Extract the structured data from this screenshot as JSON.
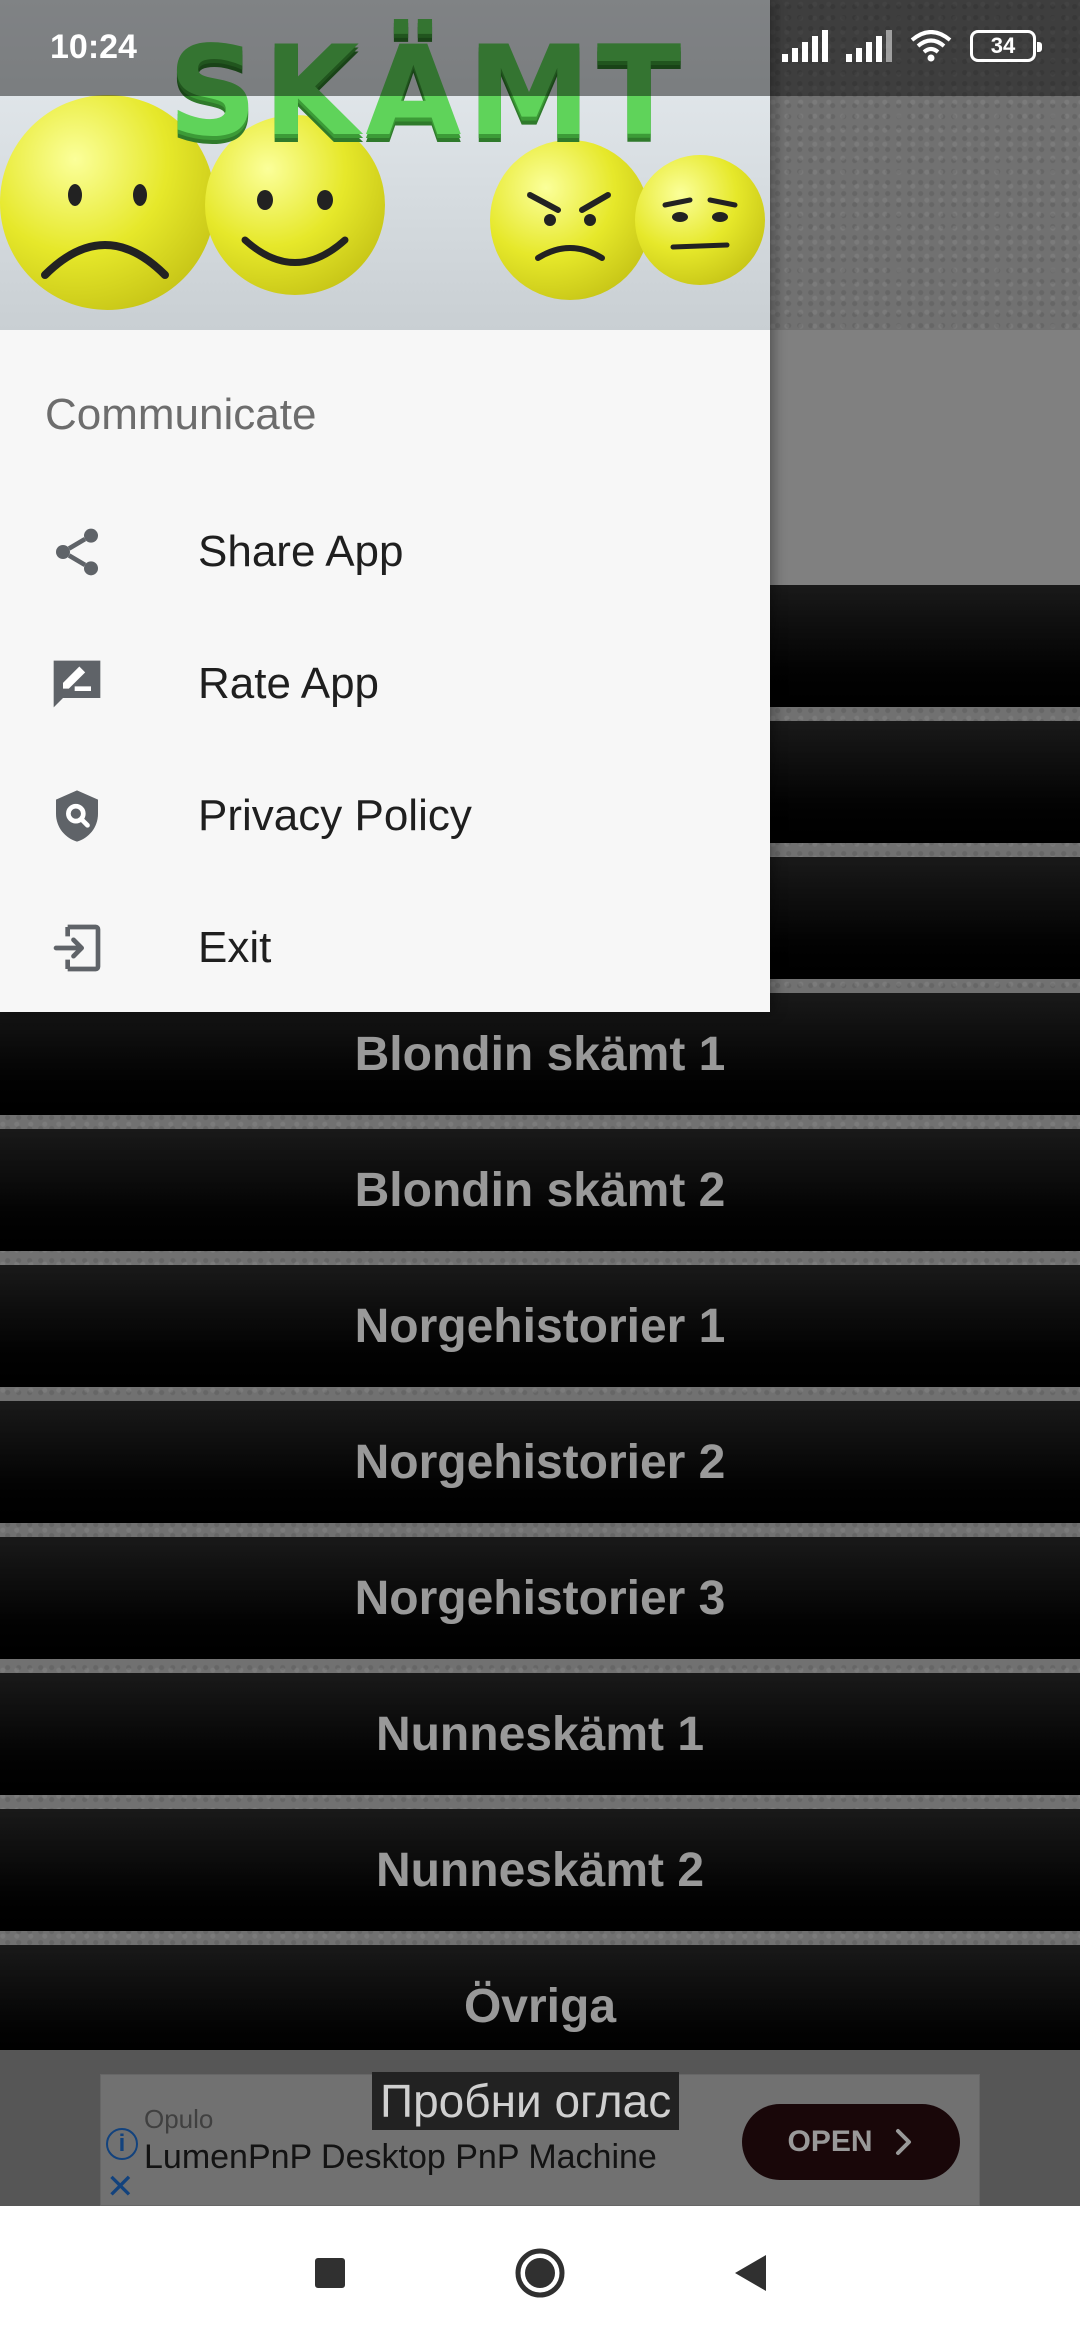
{
  "status_bar": {
    "time": "10:24",
    "battery": "34"
  },
  "drawer": {
    "logo_text": "SKÄMT",
    "section_title": "Communicate",
    "items": [
      {
        "label": "Share App",
        "icon": "share-icon"
      },
      {
        "label": "Rate App",
        "icon": "rate-review-icon"
      },
      {
        "label": "Privacy Policy",
        "icon": "privacy-shield-icon"
      },
      {
        "label": "Exit",
        "icon": "exit-icon"
      }
    ]
  },
  "categories": [
    "Blondin skämt 1",
    "Blondin skämt 2",
    "Norgehistorier 1",
    "Norgehistorier 2",
    "Norgehistorier 3",
    "Nunneskämt 1",
    "Nunneskämt 2",
    "Övriga"
  ],
  "ad": {
    "test_label": "Пробни оглас",
    "advertiser": "Opulo",
    "title": "LumenPnP Desktop PnP Machine",
    "cta": "OPEN"
  },
  "colors": {
    "logo_green": "#5fd35a",
    "ad_button": "#2a0c10",
    "ad_icon_blue": "#1f6fd1"
  }
}
